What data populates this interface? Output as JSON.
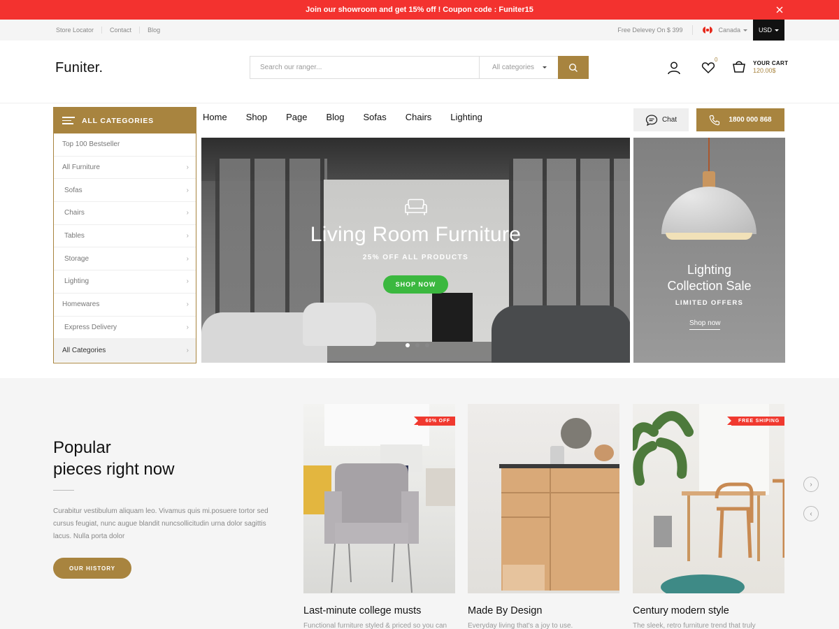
{
  "promo": {
    "text": "Join our showroom and get 15% off ! Coupon code : Funiter15"
  },
  "topbar": {
    "links": [
      "Store Locator",
      "Contact",
      "Blog"
    ],
    "shipping": "Free Delevey On $ 399",
    "country": "Canada",
    "currency": "USD"
  },
  "header": {
    "logo": "Funiter.",
    "search_placeholder": "Search our ranger...",
    "category_select": "All categories",
    "wishlist_count": "0",
    "cart_label": "YOUR CART",
    "cart_total": "120.00$"
  },
  "categories": {
    "title": "ALL CATEGORIES",
    "items": [
      {
        "label": "Top 100 Bestseller"
      },
      {
        "label": "All Furniture"
      },
      {
        "label": "Sofas"
      },
      {
        "label": "Chairs"
      },
      {
        "label": "Tables"
      },
      {
        "label": "Storage"
      },
      {
        "label": "Lighting"
      },
      {
        "label": "Homewares"
      },
      {
        "label": "Express Delivery"
      },
      {
        "label": "All Categories"
      }
    ]
  },
  "nav": {
    "items": [
      "Home",
      "Shop",
      "Page",
      "Blog",
      "Sofas",
      "Chairs",
      "Lighting"
    ],
    "chat": "Chat",
    "phone": "1800 000 868"
  },
  "hero": {
    "title": "Living Room Furniture",
    "subtitle": "25% OFF ALL PRODUCTS",
    "button": "SHOP NOW"
  },
  "side_banner": {
    "title_line1": "Lighting",
    "title_line2": "Collection Sale",
    "subtitle": "LIMITED OFFERS",
    "link": "Shop now"
  },
  "popular": {
    "title_line1": "Popular",
    "title_line2": "pieces right now",
    "description": "Curabitur vestibulum aliquam leo. Vivamus quis mi.posuere tortor sed cursus feugiat, nunc augue blandit nuncsollicitudin urna dolor sagittis lacus. Nulla porta dolor",
    "button": "OUR HISTORY",
    "cards": [
      {
        "title": "Last-minute college musts",
        "desc": "Functional furniture styled & priced so you can",
        "badge": "60% OFF"
      },
      {
        "title": "Made By Design",
        "desc": "Everyday living that's a joy to use.",
        "badge": ""
      },
      {
        "title": "Century modern style",
        "desc": "The sleek, retro furniture trend that truly",
        "badge": "FREE SHIPING"
      }
    ]
  },
  "colors": {
    "accent": "#a8843f",
    "promo": "#f3322f",
    "green": "#3bb83f"
  }
}
